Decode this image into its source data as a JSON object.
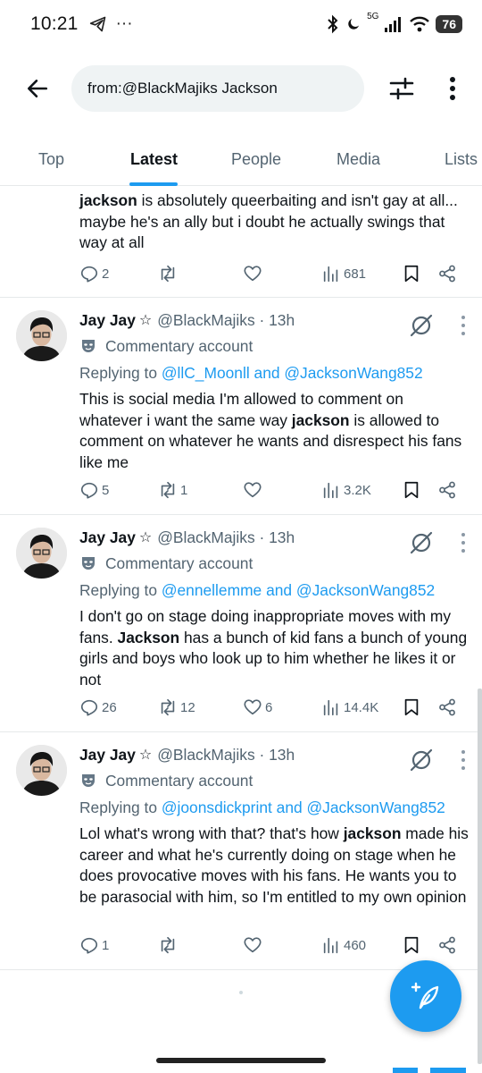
{
  "status": {
    "time": "10:21",
    "left_icons": [
      "telegram-icon",
      "more-dots"
    ],
    "overflow_dots": "···",
    "network": "5G",
    "battery": "76"
  },
  "header": {
    "search_value": "from:@BlackMajiks Jackson"
  },
  "tabs": [
    {
      "label": "Top"
    },
    {
      "label": "Latest"
    },
    {
      "label": "People"
    },
    {
      "label": "Media"
    },
    {
      "label": "Lists"
    }
  ],
  "tweets": [
    {
      "text_html": "<b>jackson</b> is absolutely queerbaiting and isn't gay at all... maybe he's an ally but i doubt he actually swings that way at all",
      "replies": "2",
      "retweets": "",
      "likes": "",
      "views": "681"
    },
    {
      "name": "Jay Jay",
      "star": "☆",
      "handle": "@BlackMajiks · 13h",
      "account_label": "Commentary account",
      "replying_prefix": "Replying to ",
      "replying_to_1": "@llC_Moonll",
      "replying_and": " and ",
      "replying_to_2": "@JacksonWang852",
      "text_html": "This is social media I'm allowed to comment on whatever i want the same way <b>jackson</b> is allowed to comment on whatever he wants and disrespect his fans like me",
      "replies": "5",
      "retweets": "1",
      "likes": "",
      "views": "3.2K"
    },
    {
      "name": "Jay Jay",
      "star": "☆",
      "handle": "@BlackMajiks · 13h",
      "account_label": "Commentary account",
      "replying_prefix": "Replying to ",
      "replying_to_1": "@ennellemme",
      "replying_and": " and ",
      "replying_to_2": "@JacksonWang852",
      "text_html": "I don't go on stage doing inappropriate moves with my fans. <b>Jackson</b> has a bunch of kid fans a bunch of young girls and boys who look up to him whether he likes it or not",
      "replies": "26",
      "retweets": "12",
      "likes": "6",
      "views": "14.4K"
    },
    {
      "name": "Jay Jay",
      "star": "☆",
      "handle": "@BlackMajiks · 13h",
      "account_label": "Commentary account",
      "replying_prefix": "Replying to ",
      "replying_to_1": "@joonsdickprint",
      "replying_and": " and ",
      "replying_to_2": "@JacksonWang852",
      "text_html": "Lol what's wrong with that? that's how <b>jackson</b> made his career and what he's currently doing on stage when he does provocative moves with his fans. He wants you to be parasocial with him, so I'm entitled to my own opinion",
      "replies": "1",
      "retweets": "",
      "likes": "",
      "views": "460"
    }
  ],
  "colors": {
    "accent": "#1d9bf0",
    "text": "#0f1419",
    "secondary": "#536471"
  }
}
